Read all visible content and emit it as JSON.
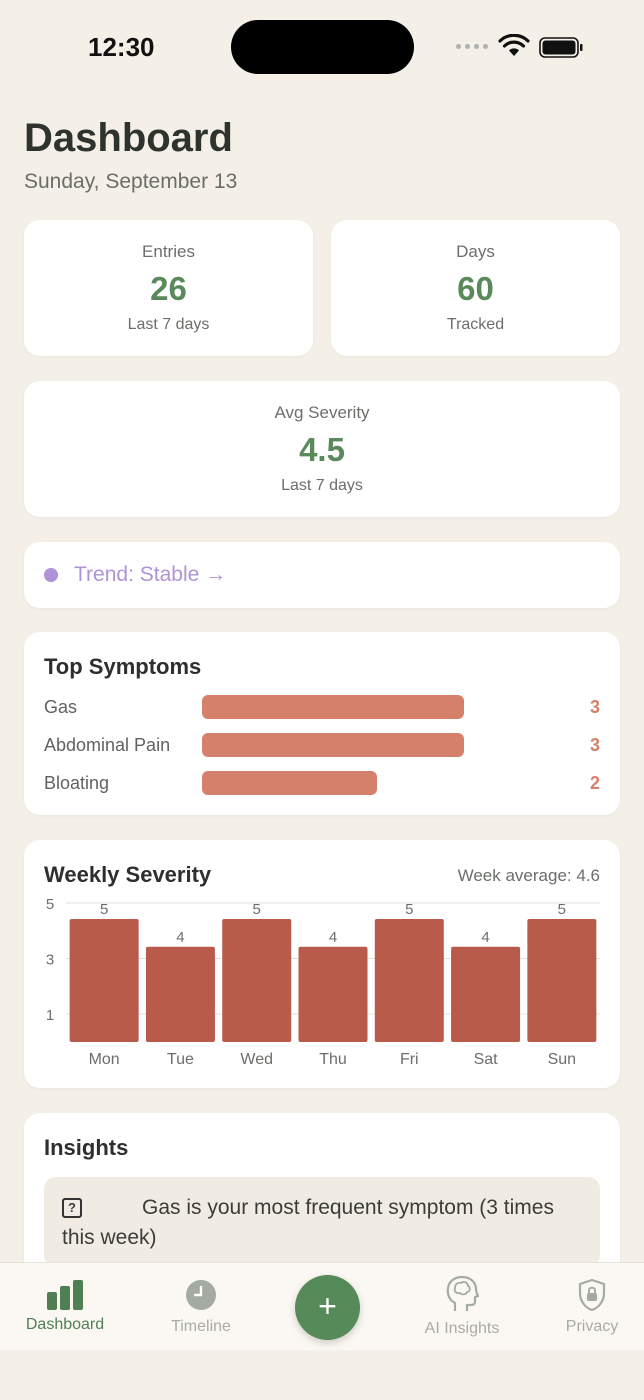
{
  "status_bar": {
    "time": "12:30"
  },
  "header": {
    "title": "Dashboard",
    "date": "Sunday, September 13"
  },
  "stats": [
    {
      "label": "Entries",
      "value": "26",
      "sub": "Last 7 days"
    },
    {
      "label": "Days",
      "value": "60",
      "sub": "Tracked"
    },
    {
      "label": "Avg Severity",
      "value": "4.5",
      "sub": "Last 7 days"
    }
  ],
  "trend": {
    "text": "Trend: Stable →",
    "color": "#b093d6"
  },
  "top_symptoms": {
    "title": "Top Symptoms",
    "items": [
      {
        "label": "Gas",
        "count": 3
      },
      {
        "label": "Abdominal Pain",
        "count": 3
      },
      {
        "label": "Bloating",
        "count": 2
      }
    ],
    "bar_color": "#d4806a"
  },
  "weekly": {
    "title": "Weekly Severity",
    "average_label": "Week average: 4.6"
  },
  "chart_data": {
    "type": "bar",
    "categories": [
      "Mon",
      "Tue",
      "Wed",
      "Thu",
      "Fri",
      "Sat",
      "Sun"
    ],
    "values": [
      5,
      4,
      5,
      4,
      5,
      4,
      5
    ],
    "yticks": [
      "5",
      "3",
      "1"
    ],
    "ylim": [
      1,
      5
    ],
    "bar_color": "#b85b4b",
    "grid": true
  },
  "insights": {
    "title": "Insights",
    "items": [
      {
        "icon": "question-icon",
        "text": "Gas is your most frequent symptom (3 times this week)"
      }
    ]
  },
  "tabbar": {
    "tabs": [
      {
        "label": "Dashboard",
        "icon": "chart-bars-icon",
        "active": true
      },
      {
        "label": "Timeline",
        "icon": "clock-icon",
        "active": false
      },
      {
        "label": "AI Insights",
        "icon": "brain-head-icon",
        "active": false
      },
      {
        "label": "Privacy",
        "icon": "shield-lock-icon",
        "active": false
      }
    ],
    "add_label": "+"
  },
  "accent_color": "#568a59"
}
